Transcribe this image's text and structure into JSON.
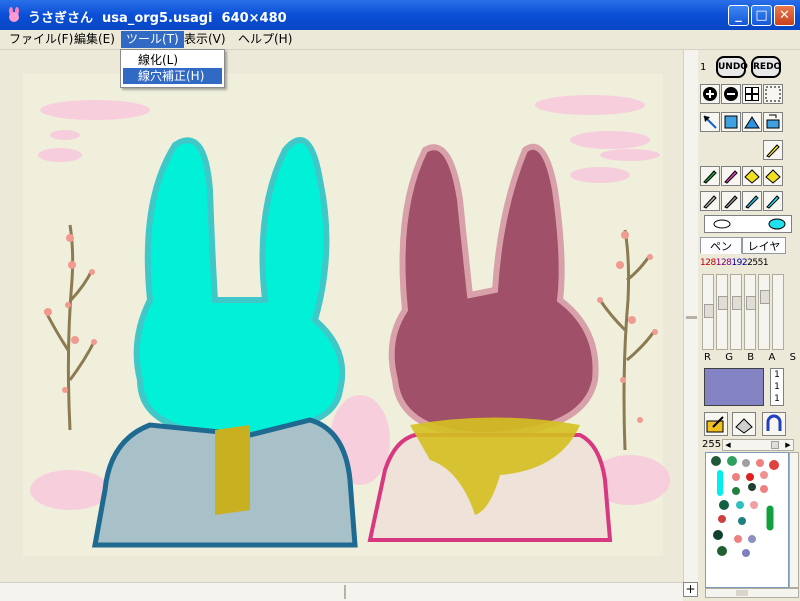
{
  "window": {
    "title": "うさぎさん  usa_org5.usagi  640×480",
    "minimize": "_",
    "maximize": "□",
    "close": "✕"
  },
  "menu": {
    "file": "ファイル(F)",
    "edit": "編集(E)",
    "tool": "ツール(T)",
    "view": "表示(V)",
    "help": "ヘルプ(H)"
  },
  "tool_menu": {
    "item1": "線化(L)",
    "item2": "線穴補正(H)"
  },
  "panel": {
    "history_index": "1",
    "undo": "UNDO",
    "redo": "REDO",
    "tab_pen": "ペン",
    "tab_layer": "レイヤ",
    "pen_sizes": [
      "1",
      "2",
      "8",
      "1",
      "2",
      "8",
      "1",
      "9",
      "2",
      "2",
      "5",
      "5",
      "1"
    ],
    "rgba_labels": [
      "R",
      "G",
      "B",
      "A",
      "S"
    ],
    "rgb_values": [
      "1",
      "1",
      "1"
    ],
    "opacity": "255",
    "current_color": "#8484c4"
  },
  "colors": {
    "title_bar": "#0a4fd6",
    "selection": "#316ac5",
    "canvas_bg": "#efefdc",
    "left_rabbit": "#00f0d8",
    "right_rabbit": "#a05068"
  }
}
